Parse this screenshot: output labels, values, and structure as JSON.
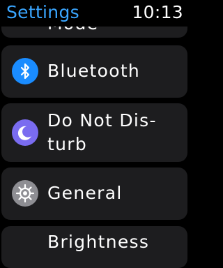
{
  "header": {
    "title": "Settings",
    "time": "10:13"
  },
  "rows": [
    {
      "label": "Mode"
    },
    {
      "label": "Bluetooth",
      "icon": "bluetooth-icon",
      "icon_color": "#1a8cff"
    },
    {
      "label": "Do Not Dis-\nturb",
      "icon": "moon-icon",
      "icon_color": "#7a6cf0"
    },
    {
      "label": "General",
      "icon": "gear-icon",
      "icon_color": "#8e8e93"
    },
    {
      "label": "Brightness"
    }
  ]
}
